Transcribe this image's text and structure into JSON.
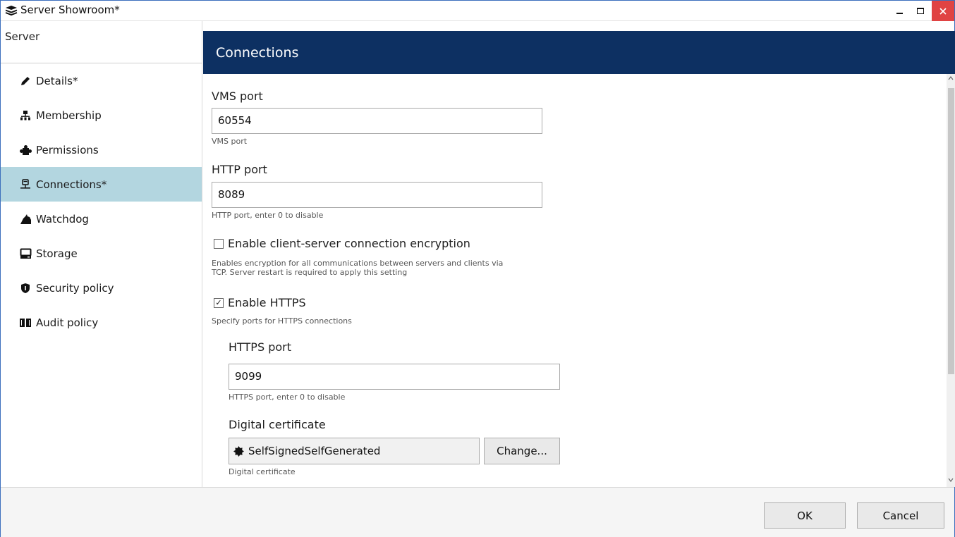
{
  "window": {
    "title": "Server Showroom*"
  },
  "sidebar": {
    "header": "Server",
    "items": [
      {
        "label": "Details*",
        "icon": "pencil-icon",
        "active": false
      },
      {
        "label": "Membership",
        "icon": "hierarchy-icon",
        "active": false
      },
      {
        "label": "Permissions",
        "icon": "puzzle-icon",
        "active": false
      },
      {
        "label": "Connections*",
        "icon": "network-icon",
        "active": true
      },
      {
        "label": "Watchdog",
        "icon": "dog-icon",
        "active": false
      },
      {
        "label": "Storage",
        "icon": "drive-icon",
        "active": false
      },
      {
        "label": "Security policy",
        "icon": "shield-icon",
        "active": false
      },
      {
        "label": "Audit policy",
        "icon": "book-icon",
        "active": false
      }
    ]
  },
  "main": {
    "header": "Connections",
    "vms_port": {
      "label": "VMS port",
      "value": "60554",
      "hint": "VMS port"
    },
    "http_port": {
      "label": "HTTP port",
      "value": "8089",
      "hint": "HTTP port, enter 0 to disable"
    },
    "encryption": {
      "label": "Enable client-server connection encryption",
      "checked": false,
      "hint_line1": "Enables encryption for all communications between servers and clients via",
      "hint_line2": "TCP. Server restart is required to apply this setting"
    },
    "https": {
      "label": "Enable HTTPS",
      "checked": true,
      "checkmark": "✓",
      "hint": "Specify ports for HTTPS connections"
    },
    "https_port": {
      "label": "HTTPS port",
      "value": "9099",
      "hint": "HTTPS port, enter 0 to disable"
    },
    "certificate": {
      "label": "Digital certificate",
      "value": "SelfSignedSelfGenerated",
      "change_label": "Change...",
      "hint": "Digital certificate"
    }
  },
  "footer": {
    "ok_label": "OK",
    "cancel_label": "Cancel"
  },
  "colors": {
    "header_bg": "#0d3062",
    "active_item_bg": "#b3d6e0",
    "close_button_bg": "#e04343"
  }
}
